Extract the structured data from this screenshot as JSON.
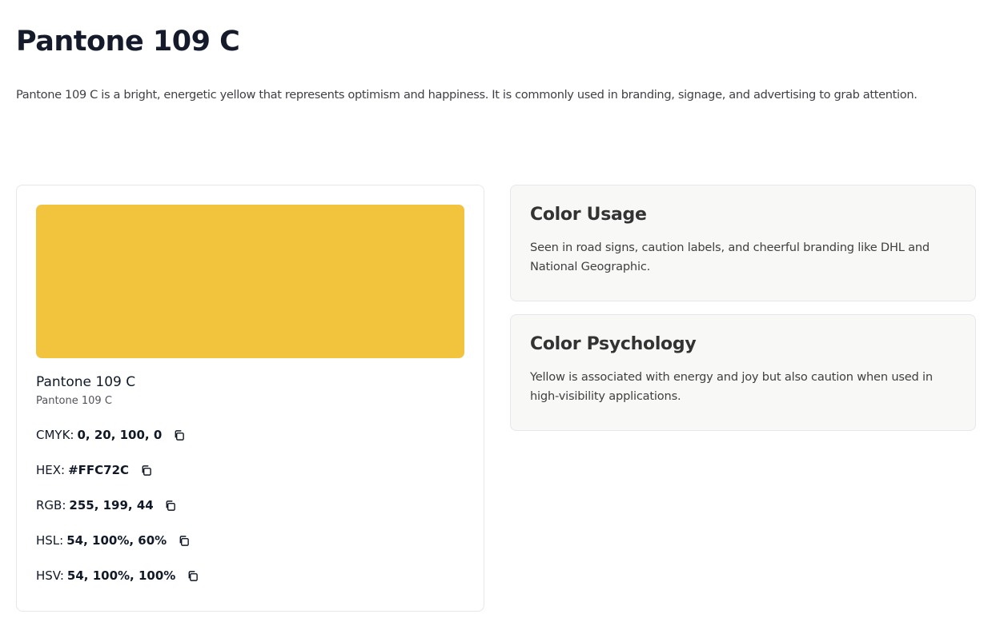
{
  "page": {
    "title": "Pantone 109 C",
    "description": "Pantone 109 C is a bright, energetic yellow that represents optimism and happiness. It is commonly used in branding, signage, and advertising to grab attention."
  },
  "swatch": {
    "color": "#F2C43D",
    "name": "Pantone 109 C",
    "subname": "Pantone 109 C",
    "values": [
      {
        "label": "CMYK:",
        "value": "0, 20, 100, 0",
        "icon": "copy-icon"
      },
      {
        "label": "HEX:",
        "value": "#FFC72C",
        "icon": "copy-icon"
      },
      {
        "label": "RGB:",
        "value": "255, 199, 44",
        "icon": "copy-icon"
      },
      {
        "label": "HSL:",
        "value": "54, 100%, 60%",
        "icon": "copy-icon"
      },
      {
        "label": "HSV:",
        "value": "54, 100%, 100%",
        "icon": "copy-icon"
      }
    ]
  },
  "usage": {
    "title": "Color Usage",
    "text": "Seen in road signs, caution labels, and cheerful branding like DHL and National Geographic."
  },
  "psychology": {
    "title": "Color Psychology",
    "text": "Yellow is associated with energy and joy but also caution when used in high-visibility applications."
  }
}
